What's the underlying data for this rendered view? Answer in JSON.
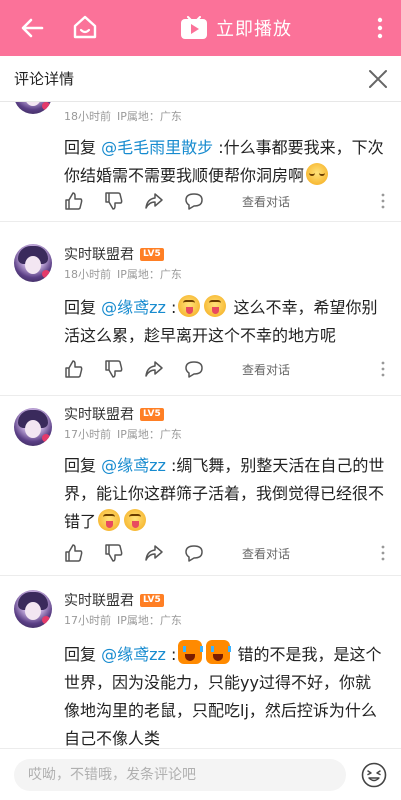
{
  "topbar": {
    "play_label": "立即播放"
  },
  "panel": {
    "title": "评论详情"
  },
  "comments": [
    {
      "username": "",
      "level": "",
      "time": "18小时前",
      "ip": "IP属地：广东",
      "reply_prefix": "回复 ",
      "mention": "@毛毛雨里散步",
      "text": " :什么事都要我来，下次你结婚需不需要我顺便帮你洞房啊",
      "view_label": "查看对话"
    },
    {
      "username": "实时联盟君",
      "level": "LV5",
      "time": "18小时前",
      "ip": "IP属地：广东",
      "reply_prefix": "回复 ",
      "mention": "@缘鸢zz",
      "text_before": " :",
      "text": " 这么不幸，希望你别活这么累，趁早离开这个不幸的地方呢",
      "view_label": "查看对话"
    },
    {
      "username": "实时联盟君",
      "level": "LV5",
      "time": "17小时前",
      "ip": "IP属地：广东",
      "reply_prefix": "回复 ",
      "mention": "@缘鸢zz",
      "text": " :绸飞舞，别整天活在自己的世界，能让你这群筛子活着，我倒觉得已经很不错了",
      "view_label": "查看对话"
    },
    {
      "username": "实时联盟君",
      "level": "LV5",
      "time": "17小时前",
      "ip": "IP属地：广东",
      "reply_prefix": "回复 ",
      "mention": "@缘鸢zz",
      "text_before": " :",
      "text": " 错的不是我，是这个世界，因为没能力，只能yy过得不好，你就像地沟里的老鼠，只配吃lj，然后控诉为什么自己不像人类",
      "view_label": "查看对话"
    }
  ],
  "bottombar": {
    "placeholder": "哎呦，不错哦，发条评论吧"
  },
  "colors": {
    "brand": "#fb7299",
    "mention": "#178bcf",
    "level_badge": "#ff7f24"
  }
}
